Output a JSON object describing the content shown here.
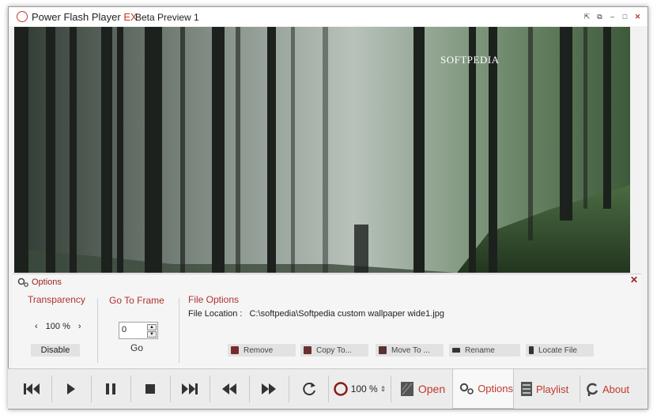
{
  "window": {
    "app_name": "Power Flash Player",
    "app_suffix": "EX",
    "subtitle": "Beta Preview 1",
    "controls": [
      "restore-small",
      "compact",
      "minimize",
      "maximize",
      "close"
    ]
  },
  "video": {
    "watermark": "SOFTPEDIA"
  },
  "options_panel": {
    "title": "Options",
    "transparency": {
      "label": "Transparency",
      "value": "100 %",
      "disable_label": "Disable"
    },
    "go_to_frame": {
      "label": "Go To Frame",
      "value": "0",
      "go_label": "Go"
    },
    "file_options": {
      "label": "File Options",
      "location_label": "File Location :",
      "location_value": "C:\\softpedia\\Softpedia custom wallpaper wide1.jpg",
      "buttons": [
        "Remove",
        "Copy To...",
        "Move To ...",
        "Rename",
        "Locate File"
      ]
    }
  },
  "toolbar": {
    "zoom": "100 %",
    "open_label": "Open",
    "tabs": [
      {
        "label": "Options",
        "icon": "gears-icon",
        "active": true
      },
      {
        "label": "Playlist",
        "icon": "playlist-icon",
        "active": false
      },
      {
        "label": "About",
        "icon": "about-icon",
        "active": false
      }
    ]
  },
  "colors": {
    "accent": "#c0392b",
    "panel_bg": "#f5f5f5",
    "toolbar_bg": "#ececec"
  }
}
